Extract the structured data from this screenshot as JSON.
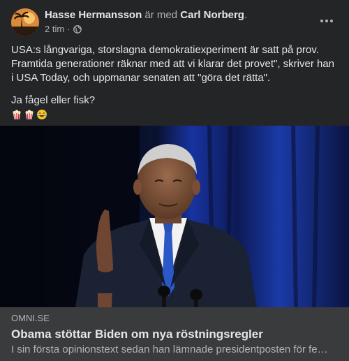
{
  "post": {
    "author": "Hasse Hermansson",
    "with_text": "är med",
    "tagged": "Carl Norberg",
    "tagged_suffix": ".",
    "time": "2 tim",
    "separator": "·",
    "audience_icon": "globe-icon",
    "more_icon": "more-options-icon",
    "paragraphs": [
      "USA:s långvariga, storslagna demokratiexperiment är satt på prov. Framtida generationer räknar med att vi klarar det provet\", skriver han i USA Today, och uppmanar senaten att \"göra det rätta\".",
      "Ja fågel eller fisk?"
    ],
    "emojis": [
      "popcorn-emoji",
      "popcorn-emoji",
      "laughing-tears-emoji"
    ]
  },
  "link": {
    "domain": "OMNI.SE",
    "title": "Obama stöttar Biden om nya röstningsregler",
    "description": "I sin första opinionstext sedan han lämnade presidentposten för fe…"
  },
  "colors": {
    "card_bg": "#242526",
    "preview_bg": "#3a3b3c",
    "primary_text": "#e4e6eb",
    "secondary_text": "#b0b3b8",
    "stage_blue": "#1f3fae"
  }
}
